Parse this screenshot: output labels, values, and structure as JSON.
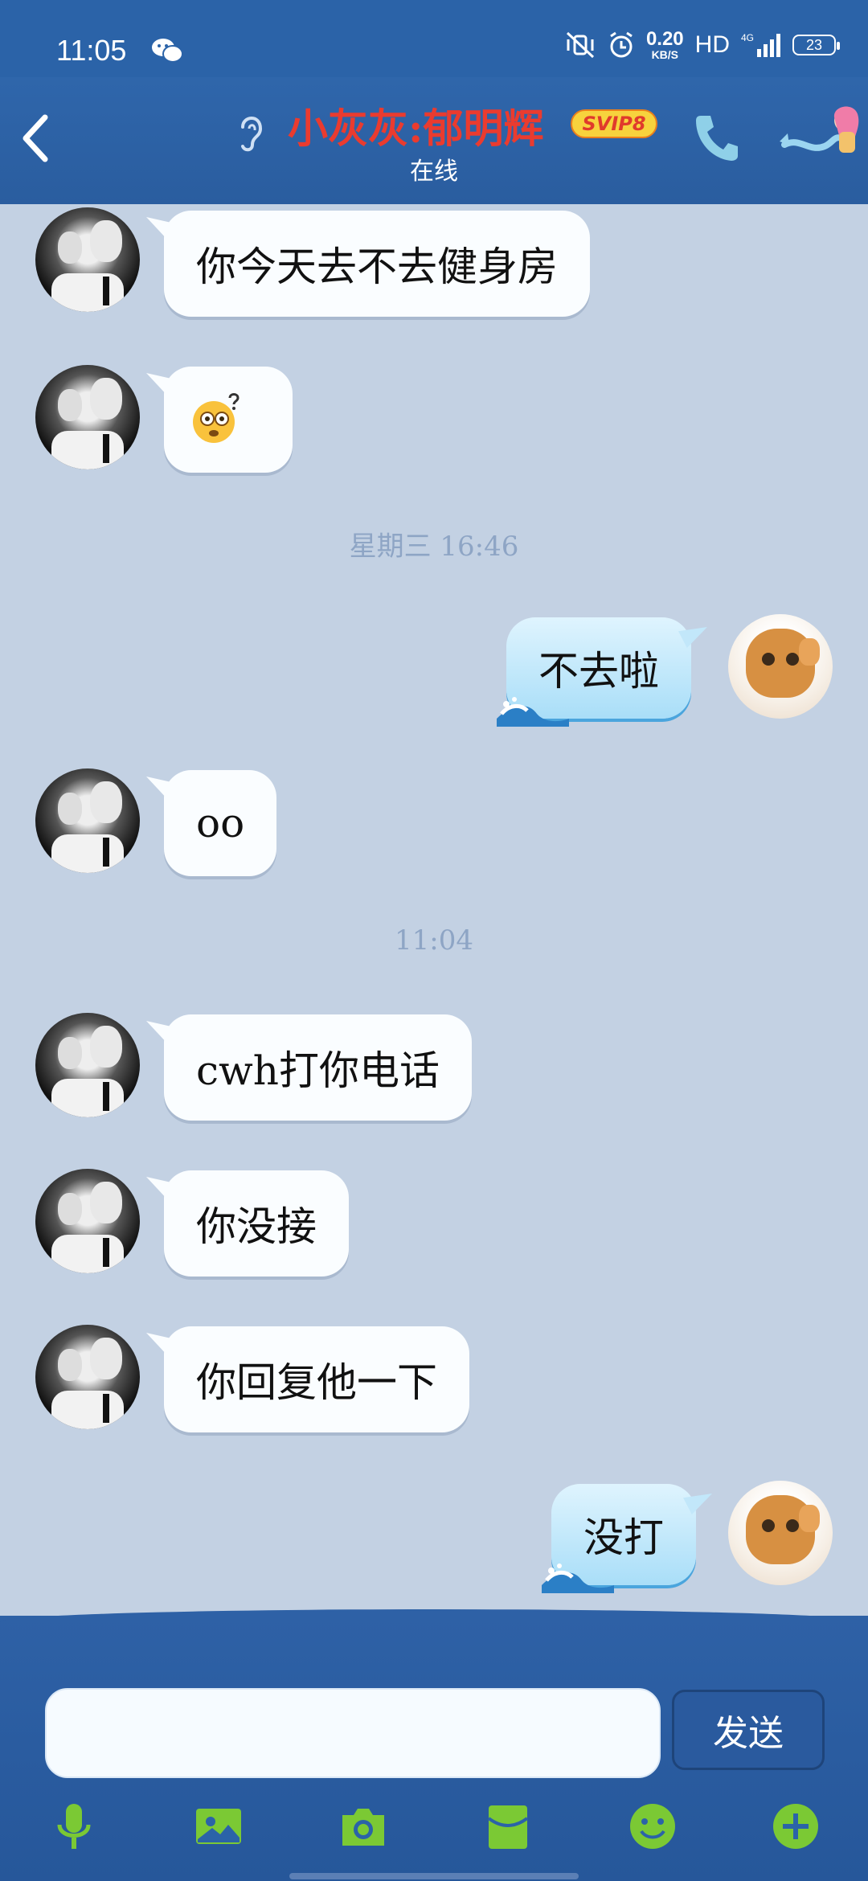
{
  "status_bar": {
    "time": "11:05",
    "speed_value": "0.20",
    "speed_unit": "KB/S",
    "hd": "HD",
    "network": "4G",
    "battery": "23"
  },
  "header": {
    "title": "小灰灰:郁明辉",
    "badge": "SVIP8",
    "status": "在线"
  },
  "messages": [
    {
      "side": "left",
      "text": "你今天去不去健身房"
    },
    {
      "side": "left",
      "type": "emoji",
      "icon": "dizzy-face-emoji"
    },
    {
      "type": "timestamp",
      "text": "星期三 16:46"
    },
    {
      "side": "right",
      "text": "不去啦"
    },
    {
      "side": "left",
      "text": "oo"
    },
    {
      "type": "timestamp",
      "text": "11:04"
    },
    {
      "side": "left",
      "text": "cwh打你电话"
    },
    {
      "side": "left",
      "text": "你没接"
    },
    {
      "side": "left",
      "text": "你回复他一下"
    },
    {
      "side": "right",
      "text": "没打"
    }
  ],
  "composer": {
    "input_value": "",
    "send_label": "发送"
  },
  "toolbar": {
    "items": [
      "microphone-icon",
      "image-icon",
      "camera-icon",
      "red-packet-icon",
      "smiley-icon",
      "plus-icon"
    ]
  },
  "colors": {
    "header_bg": "#2b63a8",
    "chat_bg": "#c3d1e3",
    "title_red": "#ea3b2f",
    "tool_green": "#7bc934"
  }
}
